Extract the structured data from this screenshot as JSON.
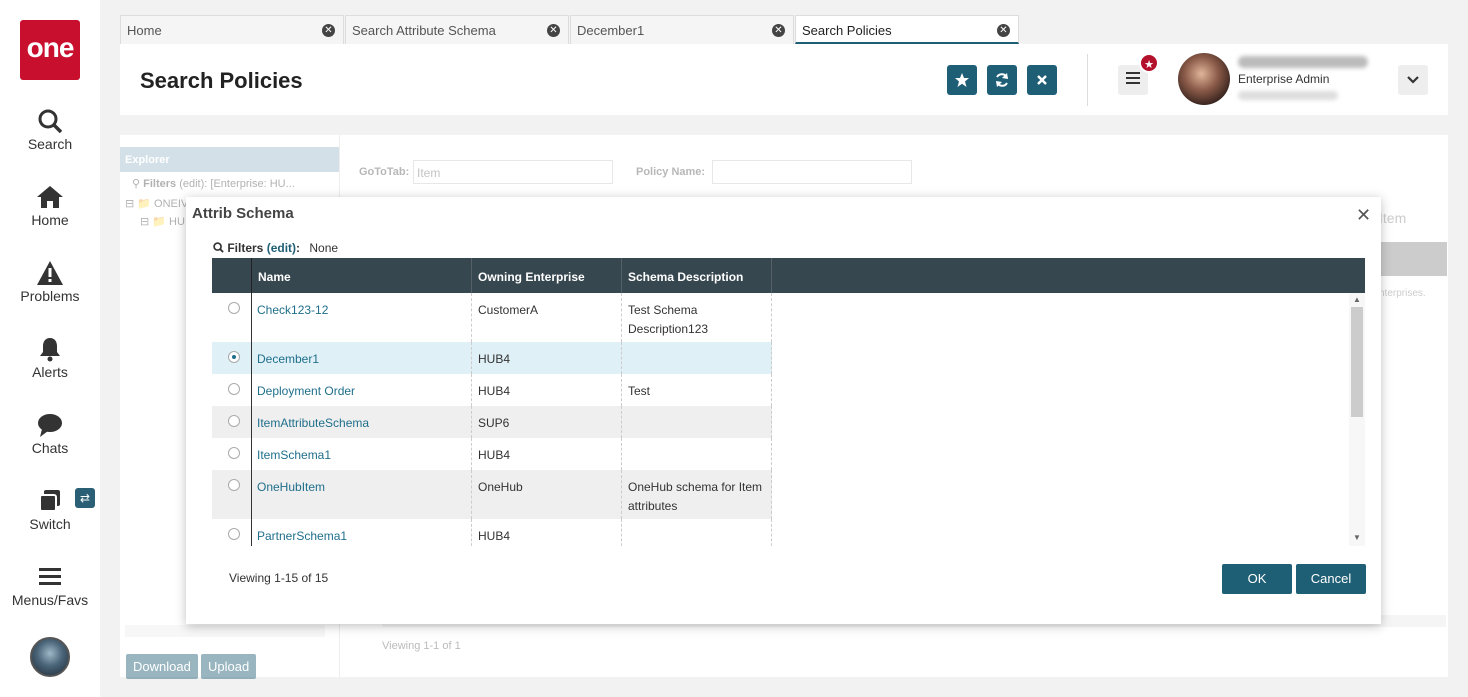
{
  "nav": {
    "logo": "one",
    "items": [
      {
        "label": "Search",
        "icon": "search-icon"
      },
      {
        "label": "Home",
        "icon": "home-icon"
      },
      {
        "label": "Problems",
        "icon": "warning-icon"
      },
      {
        "label": "Alerts",
        "icon": "bell-icon"
      },
      {
        "label": "Chats",
        "icon": "chat-icon"
      },
      {
        "label": "Switch",
        "icon": "switch-icon"
      },
      {
        "label": "Menus/Favs",
        "icon": "hamburger-icon"
      }
    ],
    "switch_badge": "⇄"
  },
  "tabs": [
    {
      "label": "Home",
      "active": false
    },
    {
      "label": "Search Attribute Schema",
      "active": false
    },
    {
      "label": "December1",
      "active": false
    },
    {
      "label": "Search Policies",
      "active": true
    }
  ],
  "header": {
    "title": "Search Policies",
    "user_role": "Enterprise Admin"
  },
  "explorer": {
    "title": "Explorer",
    "filters_label": "Filters",
    "filters_edit": "(edit):",
    "filters_value": "[Enterprise: HU...",
    "tree_root": "ONEIV",
    "tree_child": "HU",
    "download": "Download",
    "upload": "Upload"
  },
  "search_form": {
    "goto_label": "GoToTab:",
    "goto_value": "Item",
    "policy_label": "Policy Name:"
  },
  "background": {
    "item_tab": "Item",
    "hint_text": "nterprises.",
    "viewing": "Viewing 1-1 of 1"
  },
  "modal": {
    "title": "Attrib Schema",
    "filters_label": "Filters",
    "filters_edit": "(edit)",
    "filters_value": "None",
    "columns": [
      "Name",
      "Owning Enterprise",
      "Schema Description"
    ],
    "rows": [
      {
        "name": "Check123-12",
        "owner": "CustomerA",
        "desc": "Test Schema Description123",
        "selected": false
      },
      {
        "name": "December1",
        "owner": "HUB4",
        "desc": "",
        "selected": true
      },
      {
        "name": "Deployment Order",
        "owner": "HUB4",
        "desc": "Test",
        "selected": false
      },
      {
        "name": "ItemAttributeSchema",
        "owner": "SUP6",
        "desc": "",
        "selected": false
      },
      {
        "name": "ItemSchema1",
        "owner": "HUB4",
        "desc": "",
        "selected": false
      },
      {
        "name": "OneHubItem",
        "owner": "OneHub",
        "desc": "OneHub schema for Item attributes",
        "selected": false
      },
      {
        "name": "PartnerSchema1",
        "owner": "HUB4",
        "desc": "",
        "selected": false
      }
    ],
    "viewing": "Viewing 1-15 of 15",
    "ok": "OK",
    "cancel": "Cancel"
  },
  "colors": {
    "accent": "#1f5f75",
    "brand_red": "#c8102e",
    "grid_header": "#37474f",
    "selected_row": "#dff0f7"
  }
}
